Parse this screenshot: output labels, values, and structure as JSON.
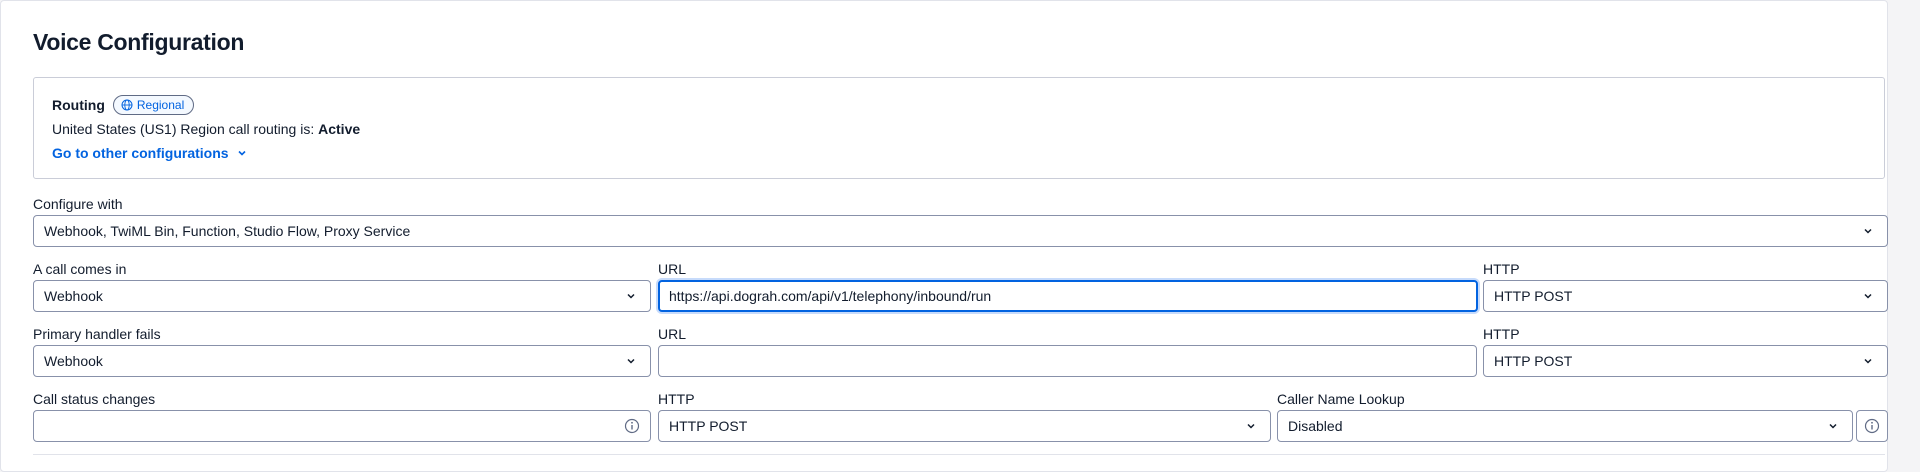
{
  "page": {
    "title": "Voice Configuration"
  },
  "routing": {
    "label": "Routing",
    "badge": "Regional",
    "status_prefix": "United States (US1) Region call routing is: ",
    "status_value": "Active",
    "link": "Go to other configurations"
  },
  "configure_with": {
    "label": "Configure with",
    "value": "Webhook, TwiML Bin, Function, Studio Flow, Proxy Service"
  },
  "call_comes_in": {
    "label": "A call comes in",
    "type_value": "Webhook",
    "url_label": "URL",
    "url_value": "https://api.dograh.com/api/v1/telephony/inbound/run",
    "http_label": "HTTP",
    "http_value": "HTTP POST"
  },
  "primary_handler_fails": {
    "label": "Primary handler fails",
    "type_value": "Webhook",
    "url_label": "URL",
    "url_value": "",
    "http_label": "HTTP",
    "http_value": "HTTP POST"
  },
  "call_status_changes": {
    "label": "Call status changes",
    "url_value": "",
    "http_label": "HTTP",
    "http_value": "HTTP POST",
    "caller_lookup_label": "Caller Name Lookup",
    "caller_lookup_value": "Disabled"
  },
  "icons": [
    "globe-icon",
    "chevron-down-icon",
    "info-icon"
  ],
  "colors": {
    "link": "#0263e0",
    "focus": "#0263e0",
    "border": "#8891aa"
  }
}
